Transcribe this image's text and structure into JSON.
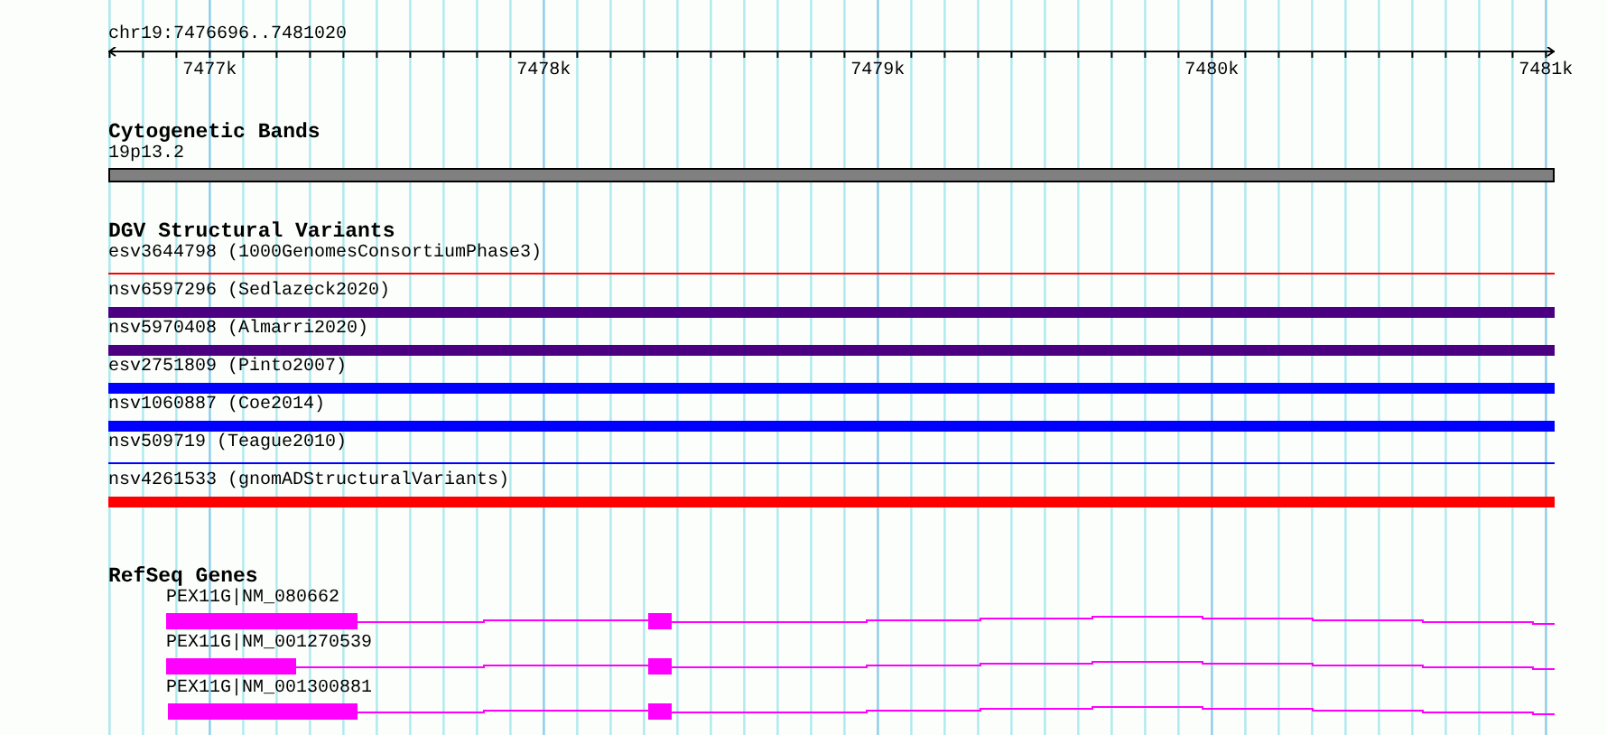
{
  "ruler": {
    "location": "chr19:7476696..7481020",
    "ticks": [
      "7477k",
      "7478k",
      "7479k",
      "7480k",
      "7481k"
    ]
  },
  "tracks": [
    {
      "kind": "cytoband",
      "title": "Cytogenetic Bands",
      "features": [
        {
          "label": "19p13.2",
          "color": "#808080"
        }
      ]
    },
    {
      "kind": "variants",
      "title": "DGV Structural Variants",
      "features": [
        {
          "label": "esv3644798 (1000GenomesConsortiumPhase3)",
          "kind": "line",
          "color": "#ff0000"
        },
        {
          "label": "nsv6597296 (Sedlazeck2020)",
          "kind": "bar",
          "color": "#4b0082"
        },
        {
          "label": "nsv5970408 (Almarri2020)",
          "kind": "bar",
          "color": "#4b0082"
        },
        {
          "label": "esv2751809 (Pinto2007)",
          "kind": "bar",
          "color": "#0000ff"
        },
        {
          "label": "nsv1060887 (Coe2014)",
          "kind": "bar",
          "color": "#0000ff"
        },
        {
          "label": "nsv509719 (Teague2010)",
          "kind": "line",
          "color": "#0000ff"
        },
        {
          "label": "nsv4261533 (gnomADStructuralVariants)",
          "kind": "bar",
          "color": "#ff0000"
        }
      ]
    },
    {
      "kind": "genes",
      "title": "RefSeq Genes",
      "features": [
        {
          "label": "PEX11G|NM_080662"
        },
        {
          "label": "PEX11G|NM_001270539"
        },
        {
          "label": "PEX11G|NM_001300881"
        }
      ]
    }
  ]
}
